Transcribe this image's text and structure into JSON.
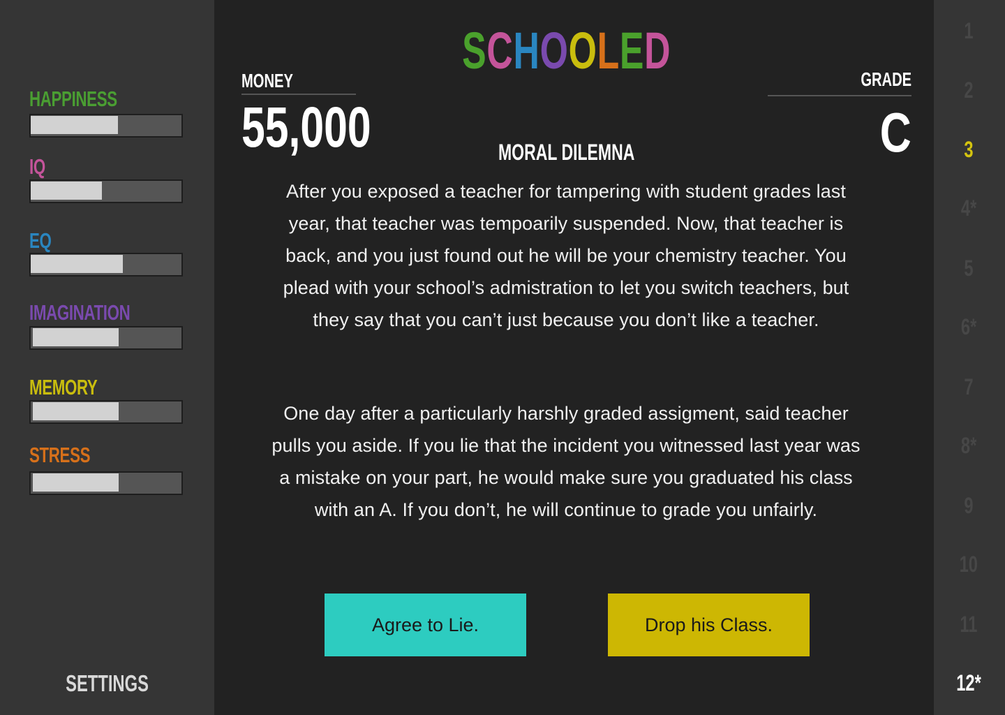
{
  "colors": {
    "happiness": "#4a9e32",
    "iq": "#c4549a",
    "eq": "#2a86c0",
    "imagination": "#7a4aae",
    "memory": "#c9bd0e",
    "stress": "#d6701a",
    "choice_a": "#2dccc0",
    "choice_b": "#cdb703",
    "level_current": "#d4c40f",
    "level_final": "#ffffff",
    "level_inactive": "#474747"
  },
  "sidebar": {
    "stats": [
      {
        "label": "HAPPINESS",
        "color": "#4a9e32",
        "level": 0.58
      },
      {
        "label": "IQ",
        "color": "#c4549a",
        "level": 0.47
      },
      {
        "label": "EQ",
        "color": "#2a86c0",
        "level": 0.61
      },
      {
        "label": "IMAGINATION",
        "color": "#7a4aae",
        "level": 0.57
      },
      {
        "label": "MEMORY",
        "color": "#c9bd0e",
        "level": 0.57
      },
      {
        "label": "STRESS",
        "color": "#d6701a",
        "level": 0.57
      }
    ],
    "settings_label": "SETTINGS"
  },
  "header": {
    "title_letters": [
      {
        "ch": "S",
        "color": "#4aa12c"
      },
      {
        "ch": "C",
        "color": "#c4549a"
      },
      {
        "ch": "H",
        "color": "#2a86c0"
      },
      {
        "ch": "O",
        "color": "#7a4aae"
      },
      {
        "ch": "O",
        "color": "#c9bd0e"
      },
      {
        "ch": "L",
        "color": "#d6701a"
      },
      {
        "ch": "E",
        "color": "#4aa12c"
      },
      {
        "ch": "D",
        "color": "#c4549a"
      }
    ],
    "money_label": "MONEY",
    "money_value": "55,000",
    "grade_label": "GRADE",
    "grade_value": "C"
  },
  "dilemma": {
    "heading": "MORAL DILEMNA",
    "paragraph_1": "After you exposed a teacher for tampering with student grades last year, that teacher was tempoarily suspended.  Now, that teacher is back, and you just found out he will be your chemistry teacher. You plead with your school’s admistration to let you switch teachers, but they say that you can’t just because you don’t like a teacher.",
    "paragraph_2": "One day after a particularly harshly graded assigment, said teacher pulls you aside.  If you lie that the incident you witnessed last year was a mistake on your part, he would make sure you graduated his class with an A.  If you don’t, he will continue to grade you unfairly.",
    "choice_a": "Agree to  Lie.",
    "choice_b": "Drop his Class."
  },
  "levels": [
    {
      "label": "1",
      "state": "inactive"
    },
    {
      "label": "2",
      "state": "inactive"
    },
    {
      "label": "3",
      "state": "current"
    },
    {
      "label": "4*",
      "state": "inactive"
    },
    {
      "label": "5",
      "state": "inactive"
    },
    {
      "label": "6*",
      "state": "inactive"
    },
    {
      "label": "7",
      "state": "inactive"
    },
    {
      "label": "8*",
      "state": "inactive"
    },
    {
      "label": "9",
      "state": "inactive"
    },
    {
      "label": "10",
      "state": "inactive"
    },
    {
      "label": "11",
      "state": "inactive"
    },
    {
      "label": "12*",
      "state": "final"
    }
  ]
}
